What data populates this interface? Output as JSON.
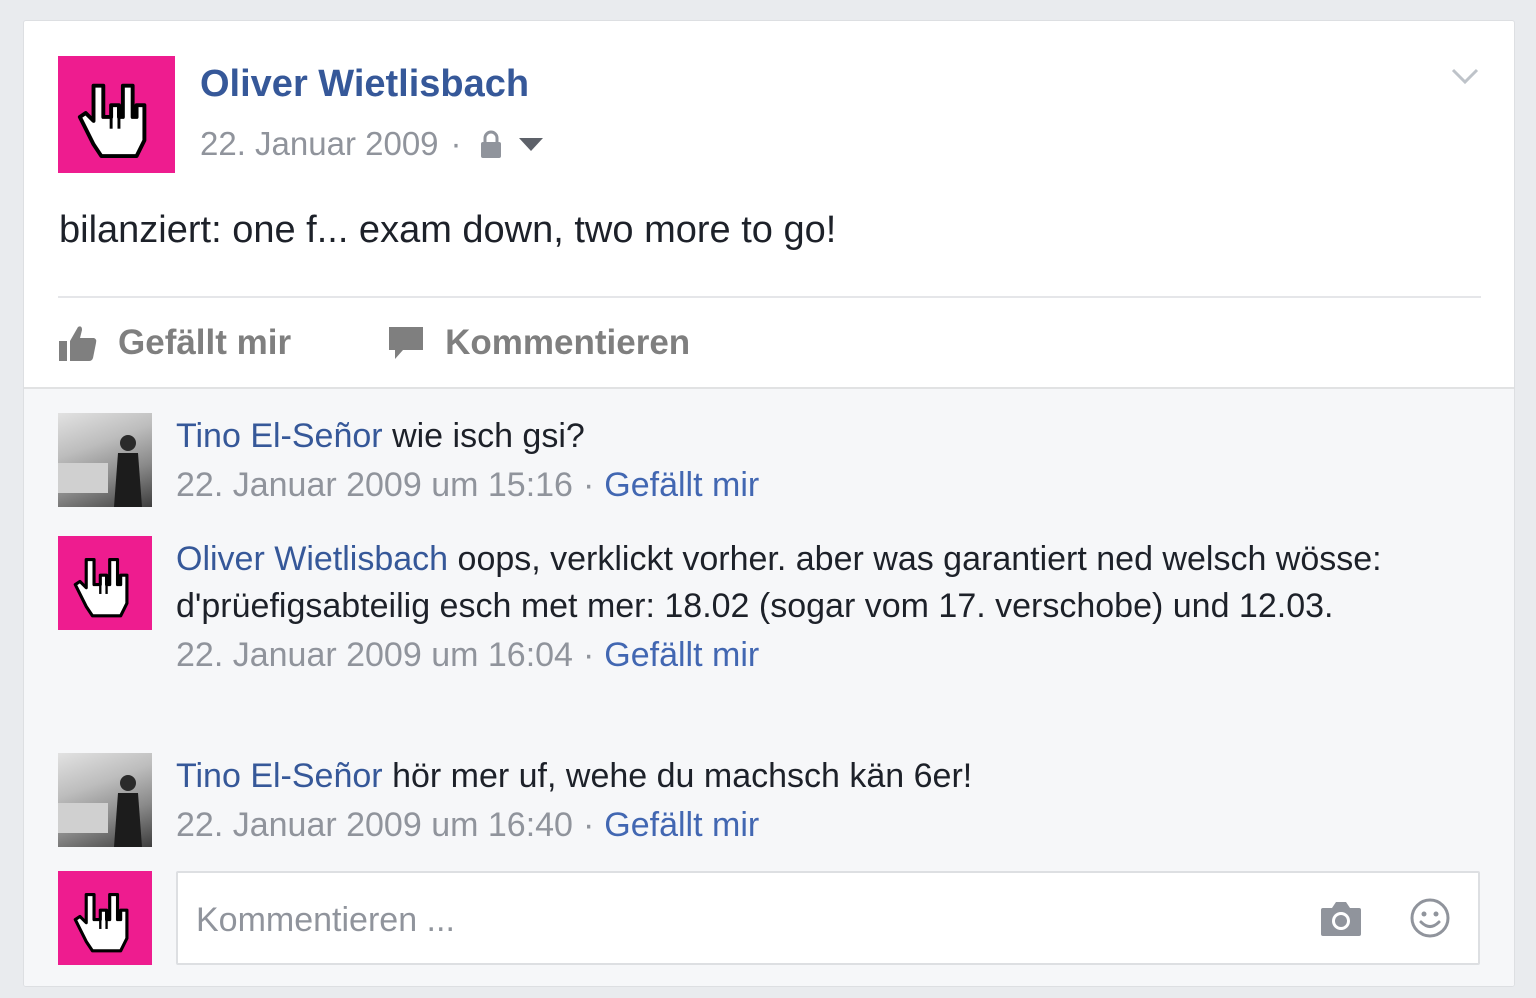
{
  "post": {
    "author": "Oliver Wietlisbach",
    "date": "22. Januar 2009",
    "separator": "·",
    "text": "bilanziert: one f... exam down, two more to go!",
    "accent_color": "#ee1c8f"
  },
  "actions": {
    "like_label": "Gefällt mir",
    "comment_label": "Kommentieren"
  },
  "comments": [
    {
      "author": "Tino El-Señor",
      "text": "wie isch gsi?",
      "timestamp": "22. Januar 2009 um 15:16",
      "separator": "·",
      "like_label": "Gefällt mir"
    },
    {
      "author": "Oliver Wietlisbach",
      "text": "oops, verklickt vorher. aber was garantiert ned welsch wösse: d'prüefigsabteilig esch met mer: 18.02 (sogar vom 17. verschobe) und 12.03.",
      "timestamp": "22. Januar 2009 um 16:04",
      "separator": "·",
      "like_label": "Gefällt mir"
    },
    {
      "author": "Tino El-Señor",
      "text": "hör mer uf, wehe du machsch kän 6er!",
      "timestamp": "22. Januar 2009 um 16:40",
      "separator": "·",
      "like_label": "Gefällt mir"
    }
  ],
  "composer": {
    "placeholder": "Kommentieren ..."
  },
  "icons": {
    "avatar": "rock-hand-icon",
    "privacy": "lock-icon",
    "audience": "caret-down-icon",
    "options": "chevron-down-icon",
    "like": "thumbs-up-icon",
    "comment": "speech-bubble-icon",
    "photo": "camera-icon",
    "emoji": "smiley-icon"
  }
}
